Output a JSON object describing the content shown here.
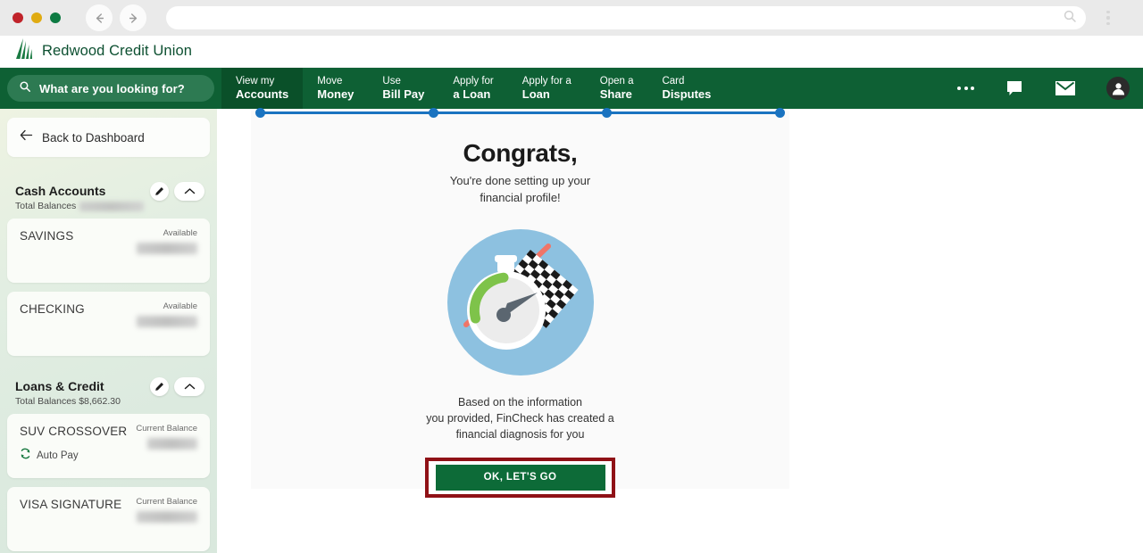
{
  "browser": {
    "traffic_lights": [
      "close",
      "minimize",
      "maximize"
    ],
    "back_icon": "back-arrow-icon",
    "forward_icon": "forward-arrow-icon",
    "address_value": "",
    "address_search_icon": "search-icon",
    "menu_icon": "kebab-menu-icon"
  },
  "header": {
    "logo_icon": "redwood-tree-logo-icon",
    "brand": "Redwood Credit Union",
    "brand_color": "#0d5031"
  },
  "global_bar": {
    "background": "#0e6034",
    "search": {
      "icon": "search-icon",
      "placeholder": "What are you looking for?",
      "value": ""
    },
    "tabs": [
      {
        "line1": "View my",
        "line2": "Accounts",
        "active": true
      },
      {
        "line1": "Move",
        "line2": "Money",
        "active": false
      },
      {
        "line1": "Use",
        "line2": "Bill Pay",
        "active": false
      },
      {
        "line1": "Apply for",
        "line2": "a Loan",
        "active": false
      },
      {
        "line1": "Apply for a",
        "line2": "Loan",
        "active": false
      },
      {
        "line1": "Open a",
        "line2": "Share",
        "active": false
      },
      {
        "line1": "Card",
        "line2": "Disputes",
        "active": false
      }
    ],
    "right_icons": [
      "more-options-icon",
      "chat-bubble-icon",
      "envelope-icon",
      "user-avatar-icon"
    ]
  },
  "sidebar": {
    "back_icon": "left-arrow-icon",
    "back_label": "Back to Dashboard",
    "groups": [
      {
        "title": "Cash Accounts",
        "total_label": "Total Balances",
        "total_value": "",
        "total_redacted": true,
        "edit_icon": "pencil-icon",
        "collapse_icon": "chevron-up-icon",
        "accounts": [
          {
            "name": "SAVINGS",
            "caption": "Available",
            "amount": "",
            "redacted": true,
            "autopay": false
          },
          {
            "name": "CHECKING",
            "caption": "Available",
            "amount": "",
            "redacted": true,
            "autopay": false
          }
        ]
      },
      {
        "title": "Loans & Credit",
        "total_label": "Total Balances $8,662.30",
        "total_value": "$8,662.30",
        "total_redacted": false,
        "edit_icon": "pencil-icon",
        "collapse_icon": "chevron-up-icon",
        "accounts": [
          {
            "name": "SUV CROSSOVER",
            "caption": "Current Balance",
            "amount": "",
            "redacted": true,
            "autopay": true,
            "autopay_label": "Auto Pay",
            "autopay_icon": "auto-pay-refresh-icon"
          },
          {
            "name": "VISA SIGNATURE",
            "caption": "Current Balance",
            "amount": "",
            "redacted": true,
            "autopay": false
          }
        ]
      }
    ]
  },
  "main": {
    "stepper": {
      "steps": 4,
      "completed": 4,
      "color": "#1a73c0"
    },
    "heading": "Congrats,",
    "subheading_line1": "You're done setting up your",
    "subheading_line2": "financial profile!",
    "illustration": {
      "name": "stopwatch-checkered-flag-illustration",
      "circle_color": "#8dc1e0",
      "gauge_color": "#7ec34a",
      "flag_pole_color": "#ef7568",
      "dial_color": "#f0f0f0"
    },
    "body_line1": "Based on the information",
    "body_line2": "you provided, FinCheck has created a",
    "body_line3": "financial diagnosis for you",
    "cta_label": "OK, LET'S GO",
    "cta_color": "#0d6b38",
    "highlight_color": "#8f1116"
  }
}
